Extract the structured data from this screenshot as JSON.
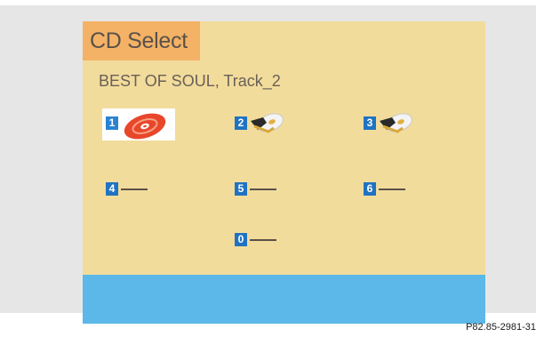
{
  "screen": {
    "title": "CD Select",
    "now_playing": "BEST OF SOUL, Track_2"
  },
  "slots": [
    {
      "number": "1",
      "state": "selected",
      "icon": "cd-disc-icon"
    },
    {
      "number": "2",
      "state": "loaded",
      "icon": "cd-loaded-icon"
    },
    {
      "number": "3",
      "state": "loaded",
      "icon": "cd-loaded-icon"
    },
    {
      "number": "4",
      "state": "empty",
      "label": "—"
    },
    {
      "number": "5",
      "state": "empty",
      "label": "—"
    },
    {
      "number": "6",
      "state": "empty",
      "label": "—"
    },
    {
      "number": "0",
      "state": "empty",
      "label": "—"
    }
  ],
  "figure_caption": "P82.85-2981-31",
  "colors": {
    "screen_bg": "#f2dc9c",
    "title_tab": "#f3b266",
    "status_bar": "#5bb8e8",
    "slot_number_bg": "#1f73c2",
    "selected_disc": "#e8472c"
  }
}
